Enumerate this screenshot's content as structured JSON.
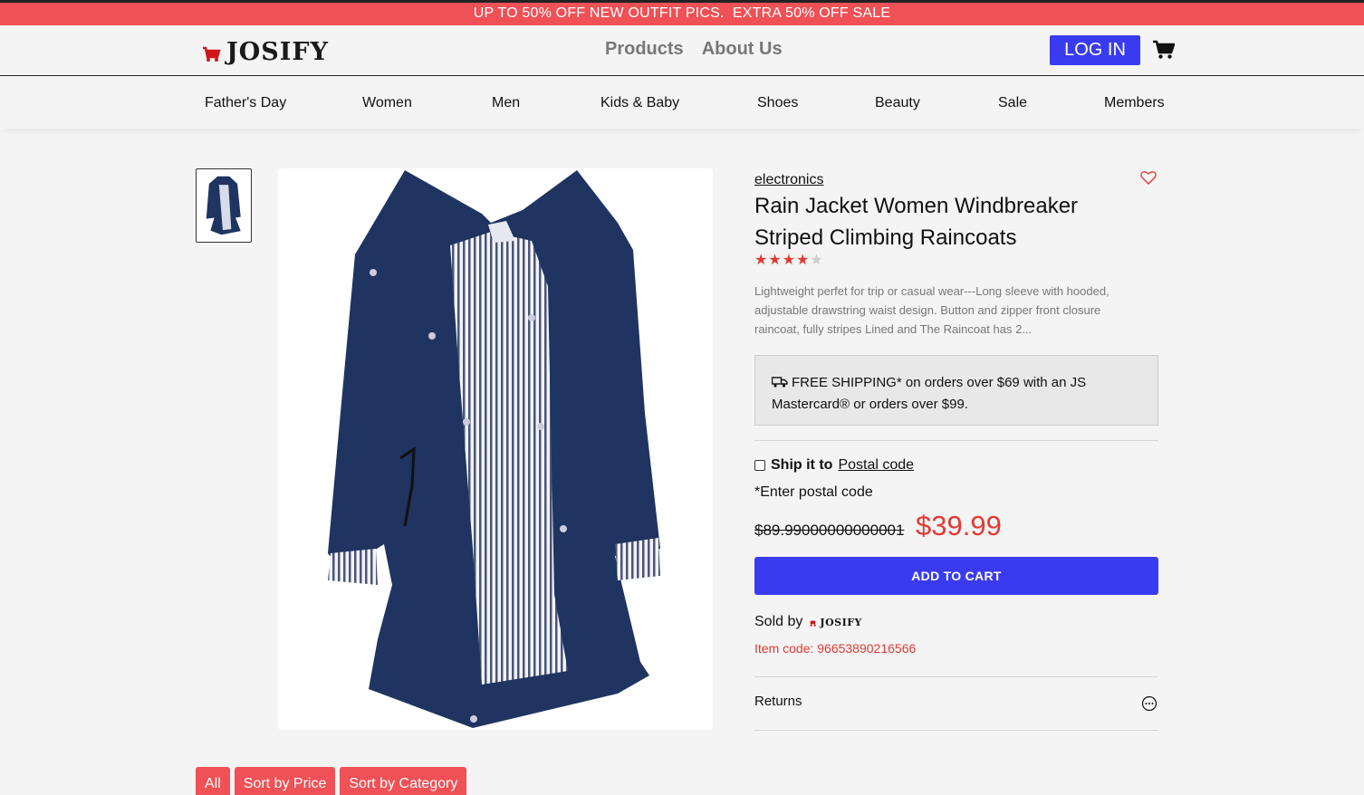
{
  "promo": {
    "text": "UP TO 50% OFF NEW OUTFIT PICS.  EXTRA 50% OFF SALE"
  },
  "header": {
    "brand": "JOSIFY",
    "nav": [
      "Products",
      "About Us"
    ],
    "login_label": "LOG IN"
  },
  "categories": [
    "Father's Day",
    "Women",
    "Men",
    "Kids & Baby",
    "Shoes",
    "Beauty",
    "Sale",
    "Members"
  ],
  "product": {
    "category": "electronics",
    "title": "Rain Jacket Women Windbreaker Striped Climbing Raincoats",
    "rating": 4,
    "rating_max": 5,
    "description": "Lightweight perfet for trip or casual wear---Long sleeve with hooded, adjustable drawstring waist design. Button and zipper front closure raincoat, fully stripes Lined and The Raincoat has 2...",
    "shipping_text": "FREE SHIPPING* on orders over $69 with an JS Mastercard® or orders over $99.",
    "ship_to_label": "Ship it to",
    "ship_to_link": "Postal code",
    "postal_note": "*Enter postal code",
    "old_price": "$89.99000000000001",
    "price": "$39.99",
    "add_to_cart_label": "ADD TO CART",
    "sold_by_label": "Sold by",
    "sold_by_brand": "JOSIFY",
    "item_code": "Item code: 96653890216566",
    "returns_label": "Returns"
  },
  "filters": [
    "All",
    "Sort by Price",
    "Sort by Category"
  ],
  "colors": {
    "accent_red": "#ef5156",
    "price_red": "#e23a33",
    "button_blue": "#3a3bf0",
    "jacket_navy": "#1f3460"
  },
  "icons": [
    "cart-logo-icon",
    "cart-icon",
    "heart-icon",
    "truck-icon",
    "more-options-icon",
    "star-icon"
  ]
}
